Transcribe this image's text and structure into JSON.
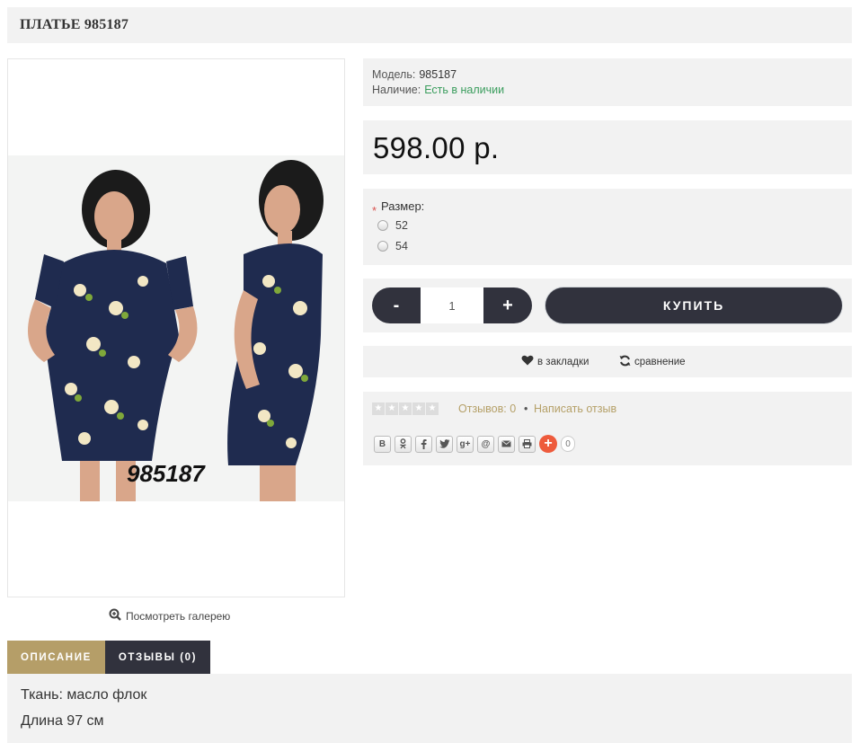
{
  "product": {
    "title": "ПЛАТЬЕ 985187",
    "image_code": "985187",
    "gallery_link": "Посмотреть галерею"
  },
  "info": {
    "model_label": "Модель:",
    "model_value": "985187",
    "stock_label": "Наличие:",
    "stock_value": "Есть в наличии",
    "stock_color": "#3a9d5d"
  },
  "price": "598.00 р.",
  "options": {
    "required_mark": "*",
    "label": "Размер:",
    "sizes": [
      "52",
      "54"
    ]
  },
  "purchase": {
    "minus": "-",
    "quantity": "1",
    "plus": "+",
    "buy_label": "КУПИТЬ",
    "button_color": "#31323d"
  },
  "actions": {
    "wishlist": "в закладки",
    "compare": "сравнение"
  },
  "reviews": {
    "rating": 0,
    "reviews_link": "Отзывов: 0",
    "separator": "•",
    "write_link": "Написать отзыв",
    "link_color": "#b5a068"
  },
  "share": {
    "buttons": [
      "vk-icon",
      "odnoklassniki-icon",
      "facebook-icon",
      "twitter-icon",
      "google-plus-icon",
      "mail-ru-icon",
      "email-icon",
      "print-icon"
    ],
    "vk": "B",
    "gplus": "g+",
    "mailru": "@",
    "more": "+",
    "count": "0"
  },
  "tabs": [
    {
      "label": "ОПИСАНИЕ",
      "active": true
    },
    {
      "label": "ОТЗЫВЫ (0)",
      "active": false
    }
  ],
  "description": {
    "line1": "Ткань: масло флок",
    "line2": "Длина 97 см"
  },
  "colors": {
    "accent_tab": "#b59e68",
    "dark": "#31323d",
    "panel_bg": "#f2f2f2"
  }
}
